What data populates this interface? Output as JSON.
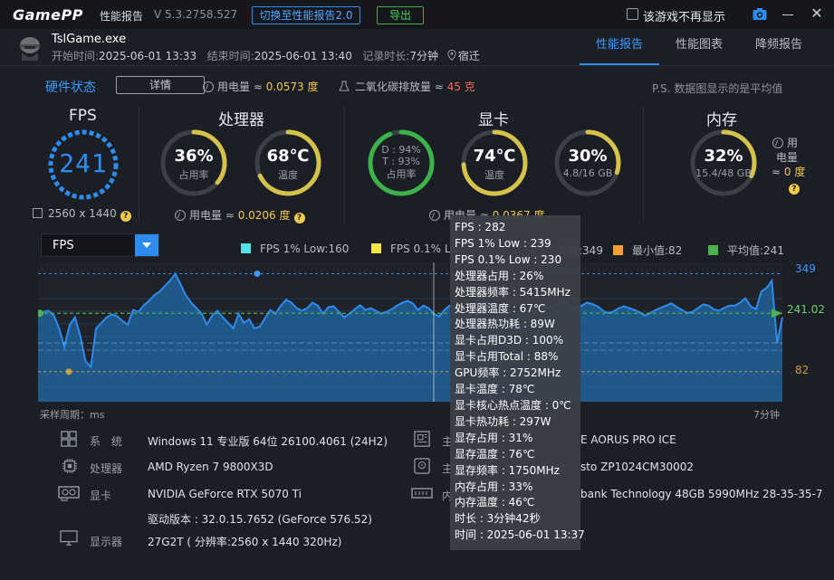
{
  "titlebar": {
    "logo": "GamePP",
    "app_title": "性能报告",
    "version": "V 5.3.2758.527",
    "switch_btn": "切换至性能报告2.0",
    "export_btn": "导出",
    "dont_show_label": "该游戏不再显示"
  },
  "session": {
    "game": "TslGame.exe",
    "start_label": "开始时间:",
    "start": "2025-06-01 13:33",
    "end_label": "结束时间:",
    "end": "2025-06-01 13:40",
    "duration_label": "记录时长:",
    "duration": "7分钟",
    "location": "宿迁"
  },
  "tabs": [
    "性能报告",
    "性能图表",
    "降频报告"
  ],
  "hardware": {
    "title": "硬件状态",
    "detail_btn": "详情",
    "power_label": "用电量 ≈",
    "power_value": "0.0573 度",
    "co2_label": "二氧化碳排放量 ≈",
    "co2_value": "45 克",
    "note": "P.S. 数据图显示的是平均值"
  },
  "gauges": {
    "fps": {
      "title": "FPS",
      "value": "241",
      "resolution": "2560 x 1440"
    },
    "cpu": {
      "title": "处理器",
      "usage": "36%",
      "usage_label": "占用率",
      "usage_level": 0.36,
      "temp": "68℃",
      "temp_label": "温度",
      "temp_level": 0.68,
      "power_label": "用电量 ≈",
      "power_value": "0.0206 度"
    },
    "gpu": {
      "title": "显卡",
      "d_line": "D : 94%",
      "t_line": "T : 93%",
      "usage_label": "占用率",
      "usage_level": 0.94,
      "temp": "74℃",
      "temp_label": "温度",
      "temp_level": 0.74,
      "vram": "30%",
      "vram_detail": "4.8/16 GB",
      "vram_level": 0.3,
      "power_label": "用电量 ≈",
      "power_value": "0.0367 度"
    },
    "mem": {
      "title": "内存",
      "usage": "32%",
      "detail": "15.4/48 GB",
      "usage_level": 0.32,
      "power_label1": "用",
      "power_label2": "电量",
      "power_label3": "≈",
      "power_value": "0 度"
    }
  },
  "chart": {
    "selector": "FPS",
    "legend": [
      {
        "label": "FPS 1% Low:160",
        "color": "#4fe3e3"
      },
      {
        "label": "FPS 0.1% Lo",
        "color": "#f5e44a"
      },
      {
        "label": "大值:349",
        "color": ""
      },
      {
        "label": "最小值:82",
        "color": "#f0a030"
      },
      {
        "label": "平均值:241",
        "color": "#4caf50"
      }
    ],
    "max_label": "349",
    "avg_label": "241.02",
    "min_label": "82",
    "sample_period": "采样周期：ms",
    "duration_label": "7分钟",
    "colors": {
      "line": "#2d8cf0",
      "fill": "#1f5d93",
      "max": "#2d8cf0",
      "avg": "#4caf50",
      "min": "#c9a03a"
    }
  },
  "chart_data": {
    "type": "area",
    "title": "FPS",
    "xlabel": "",
    "ylabel": "",
    "ylim": [
      0,
      360
    ],
    "x_range": [
      "0",
      "7分钟"
    ],
    "reference_lines": {
      "max": 349,
      "avg": 241.02,
      "min": 82,
      "low_1pct": 160
    },
    "series": [
      {
        "name": "FPS",
        "values": [
          240,
          245,
          248,
          235,
          200,
          150,
          210,
          230,
          180,
          110,
          95,
          200,
          215,
          230,
          238,
          233,
          220,
          210,
          250,
          245,
          262,
          275,
          290,
          300,
          315,
          330,
          349,
          320,
          290,
          270,
          255,
          240,
          210,
          235,
          248,
          230,
          215,
          200,
          240,
          215,
          225,
          200,
          205,
          228,
          250,
          240,
          262,
          278,
          270,
          255,
          248,
          255,
          270,
          262,
          240,
          258,
          260,
          245,
          230,
          240,
          252,
          263,
          250,
          255,
          248,
          240,
          245,
          252,
          262,
          270,
          275,
          268,
          250,
          262,
          255,
          240,
          232,
          250,
          262,
          256,
          248,
          255,
          262,
          270,
          290,
          272,
          265,
          255,
          260,
          250,
          244,
          238,
          232,
          238,
          248,
          262,
          258,
          256,
          262,
          275,
          270,
          258,
          252,
          262,
          270,
          266,
          260,
          248,
          242,
          246,
          255,
          260,
          255,
          250,
          243,
          235,
          242,
          250,
          256,
          262,
          268,
          258,
          250,
          242,
          245,
          255,
          265,
          262,
          252,
          248,
          256,
          262,
          262,
          270,
          282,
          260,
          252,
          300,
          310,
          330,
          160,
          230
        ]
      }
    ]
  },
  "tooltip": [
    "FPS : 282",
    "FPS 1% Low : 239",
    "FPS 0.1% Low : 230",
    "处理器占用 : 26%",
    "处理器频率 : 5415MHz",
    "处理器温度 : 67℃",
    "处理器热功耗 : 89W",
    "显卡占用D3D : 100%",
    "显卡占用Total : 88%",
    "GPU频率 : 2752MHz",
    "显卡温度 : 78℃",
    "显卡核心热点温度 : 0℃",
    "显卡热功耗 : 297W",
    "显存占用 : 31%",
    "显存温度 : 76℃",
    "显存频率 : 1750MHz",
    "内存占用 : 33%",
    "内存温度 : 46℃",
    "时长 : 3分钟42秒",
    "时间 : 2025-06-01 13:37"
  ],
  "system": {
    "os_label": "系　统",
    "os": "Windows 11 专业版 64位 26100.4061 (24H2)",
    "cpu_label": "处理器",
    "cpu": "AMD Ryzen 7 9800X3D",
    "gpu_label": "显卡",
    "gpu": "NVIDIA GeForce RTX 5070 Ti",
    "driver": "驱动版本 : 32.0.15.7652 (GeForce 576.52)",
    "display_label": "显示器",
    "display": "27G2T ( 分辨率:2560 x 1440 320Hz)",
    "board_label": "主",
    "board": "E AORUS PRO ICE",
    "disk_label": "主",
    "disk": "sto ZP1024CM30002",
    "mem_label": "内",
    "mem": "bank Technology 48GB 5990MHz 28-35-35-7"
  }
}
